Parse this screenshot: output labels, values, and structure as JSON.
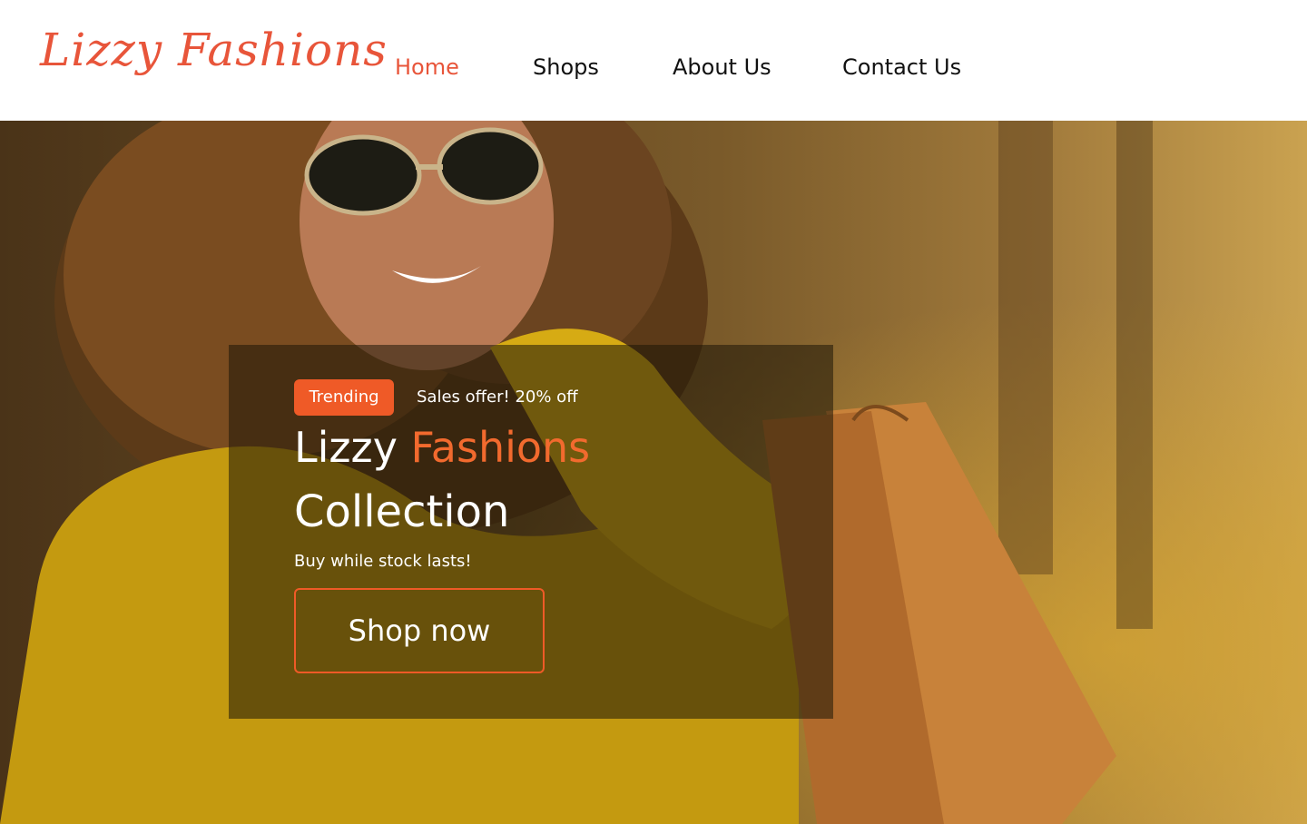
{
  "brand": {
    "logo_text": "Lizzy Fashions",
    "accent_color": "#e8553a"
  },
  "nav": {
    "items": [
      {
        "label": "Home",
        "active": true
      },
      {
        "label": "Shops",
        "active": false
      },
      {
        "label": "About Us",
        "active": false
      },
      {
        "label": "Contact Us",
        "active": false
      }
    ]
  },
  "hero": {
    "badge": "Trending",
    "offer": "Sales offer! 20% off",
    "title_part1": "Lizzy",
    "title_part2": "Fashions",
    "title_line2": "Collection",
    "subtitle": "Buy while stock lasts!",
    "cta": "Shop now",
    "badge_color": "#ef5a27"
  }
}
